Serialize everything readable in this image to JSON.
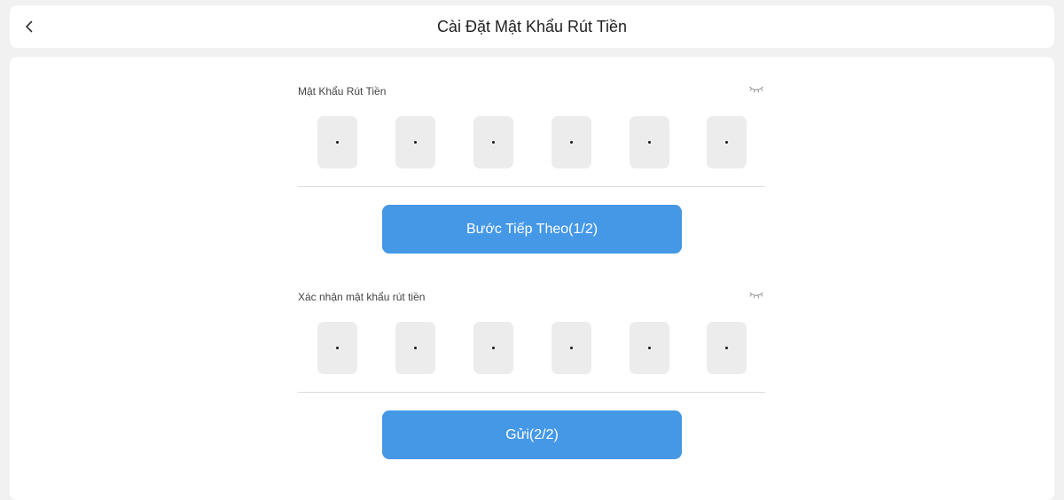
{
  "header": {
    "title": "Cài Đặt Mật Khẩu Rút Tiền",
    "back_icon": "chevron-left-icon"
  },
  "password_section": {
    "label": "Mật Khẩu Rút Tiền",
    "toggle_icon": "eye-closed-icon",
    "digits": [
      "",
      "",
      "",
      "",
      "",
      ""
    ],
    "button_label": "Bước Tiếp Theo(1/2)"
  },
  "confirm_section": {
    "label": "Xác nhận mật khẩu rút tiền",
    "toggle_icon": "eye-closed-icon",
    "digits": [
      "",
      "",
      "",
      "",
      "",
      ""
    ],
    "button_label": "Gửi(2/2)"
  },
  "colors": {
    "accent": "#4598e6",
    "pin_box": "#ececec",
    "background": "#f1f1f1"
  }
}
